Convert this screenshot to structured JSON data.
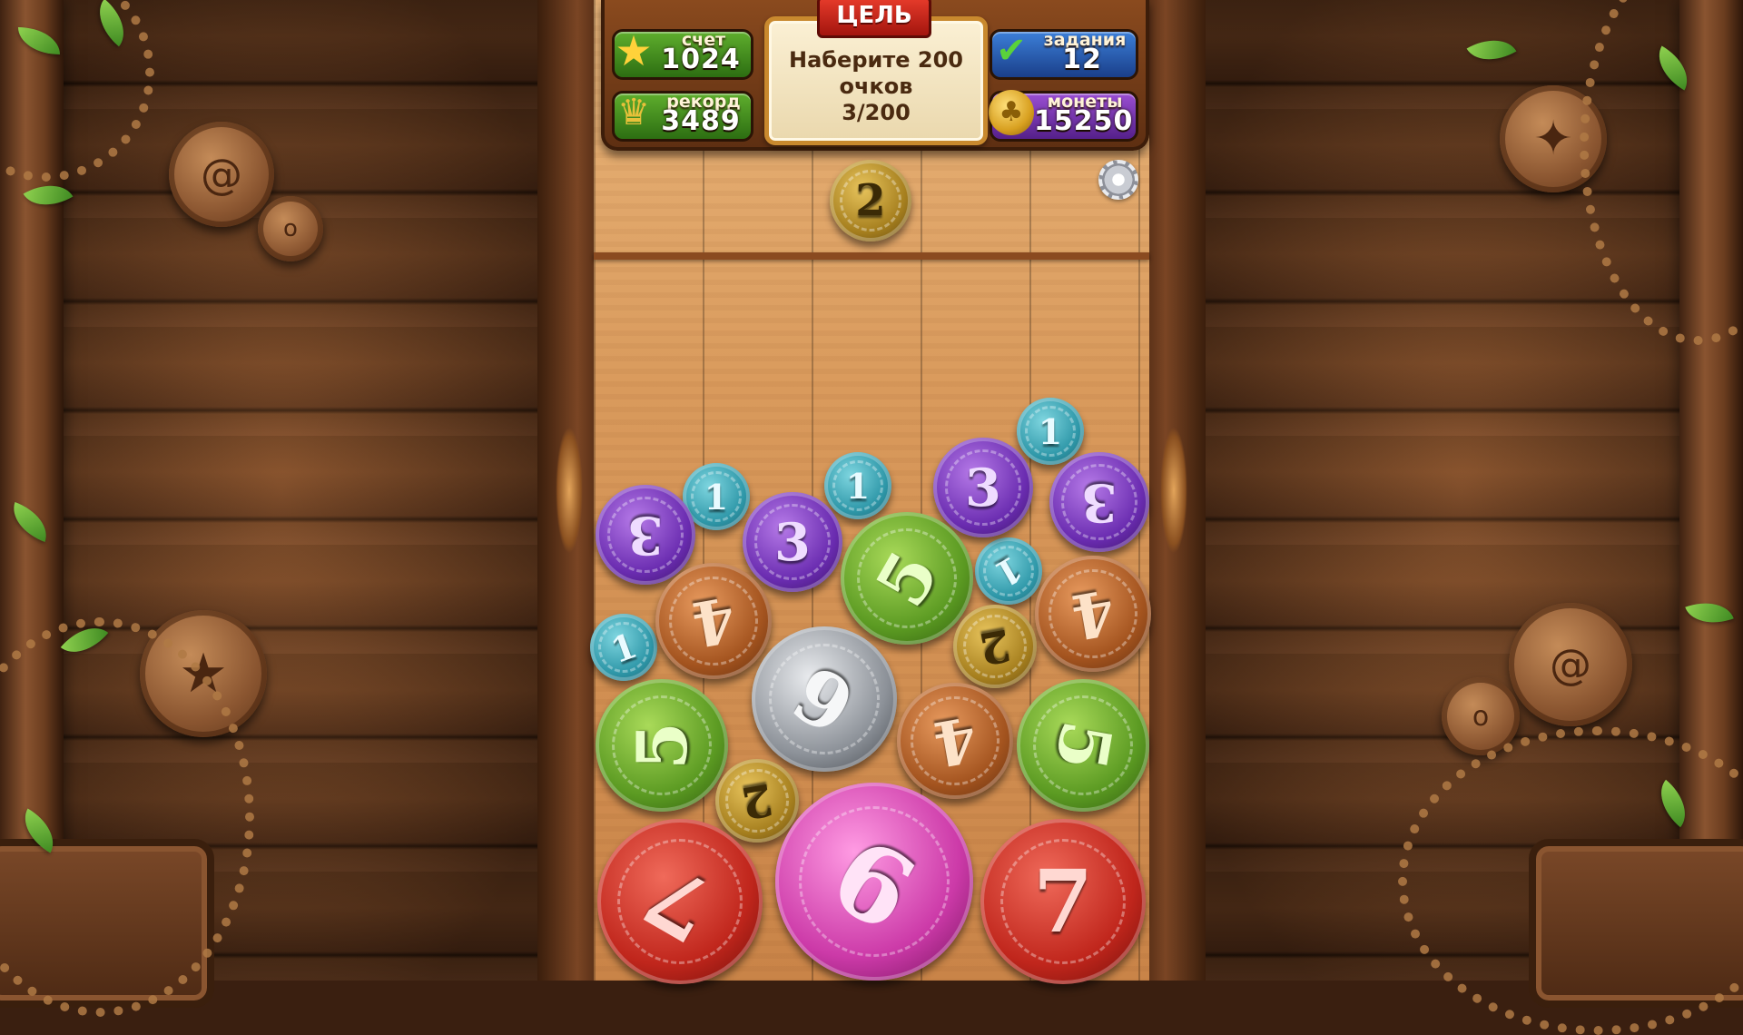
{
  "hud": {
    "score_label": "счет",
    "score_value": "1024",
    "record_label": "рекорд",
    "record_value": "3489",
    "tasks_label": "задания",
    "tasks_value": "12",
    "coins_label": "монеты",
    "coins_value": "15250",
    "goal_title": "ЦЕЛЬ",
    "goal_line1": "Наберите 200",
    "goal_line2": "очков",
    "goal_progress": "3/200"
  },
  "next_coin": {
    "value": "2",
    "kind": "gold"
  },
  "coins": [
    {
      "value": "1",
      "kind": "teal"
    },
    {
      "value": "1",
      "kind": "teal"
    },
    {
      "value": "1",
      "kind": "teal"
    },
    {
      "value": "1",
      "kind": "teal"
    },
    {
      "value": "1",
      "kind": "teal"
    },
    {
      "value": "3",
      "kind": "purple"
    },
    {
      "value": "3",
      "kind": "purple"
    },
    {
      "value": "3",
      "kind": "purple"
    },
    {
      "value": "3",
      "kind": "purple"
    },
    {
      "value": "5",
      "kind": "green"
    },
    {
      "value": "4",
      "kind": "bronze"
    },
    {
      "value": "4",
      "kind": "bronze"
    },
    {
      "value": "2",
      "kind": "gold"
    },
    {
      "value": "6",
      "kind": "silver"
    },
    {
      "value": "4",
      "kind": "bronze"
    },
    {
      "value": "5",
      "kind": "green"
    },
    {
      "value": "5",
      "kind": "green"
    },
    {
      "value": "2",
      "kind": "gold"
    },
    {
      "value": "7",
      "kind": "red"
    },
    {
      "value": "9",
      "kind": "magenta"
    },
    {
      "value": "7",
      "kind": "red"
    }
  ],
  "icons": {
    "score": "star-icon",
    "record": "trophy-icon",
    "tasks": "scroll-check-icon",
    "coins": "clover-coin-icon",
    "settings": "gear-icon"
  }
}
